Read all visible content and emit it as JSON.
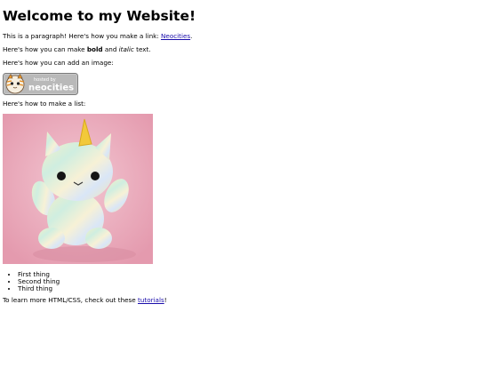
{
  "heading": "Welcome to my Website!",
  "p1": {
    "text": "This is a paragraph! Here's how you make a link: ",
    "link": "Neocities",
    "after": "."
  },
  "p2": {
    "before": "Here's how you can make ",
    "bold": "bold",
    "mid": " and ",
    "italic": "italic",
    "after": " text."
  },
  "p3": "Here's how you can add an image:",
  "badge": {
    "line1": "hosted by",
    "line2": "neocities",
    "icon": "neocities-cat-logo"
  },
  "p4": "Here's how to make a list:",
  "photo": {
    "subject": "crocheted-unicorn-plush"
  },
  "list": [
    "First thing",
    "Second thing",
    "Third thing"
  ],
  "p5": {
    "before": "To learn more HTML/CSS, check out these ",
    "link": "tutorials",
    "after": "!"
  }
}
